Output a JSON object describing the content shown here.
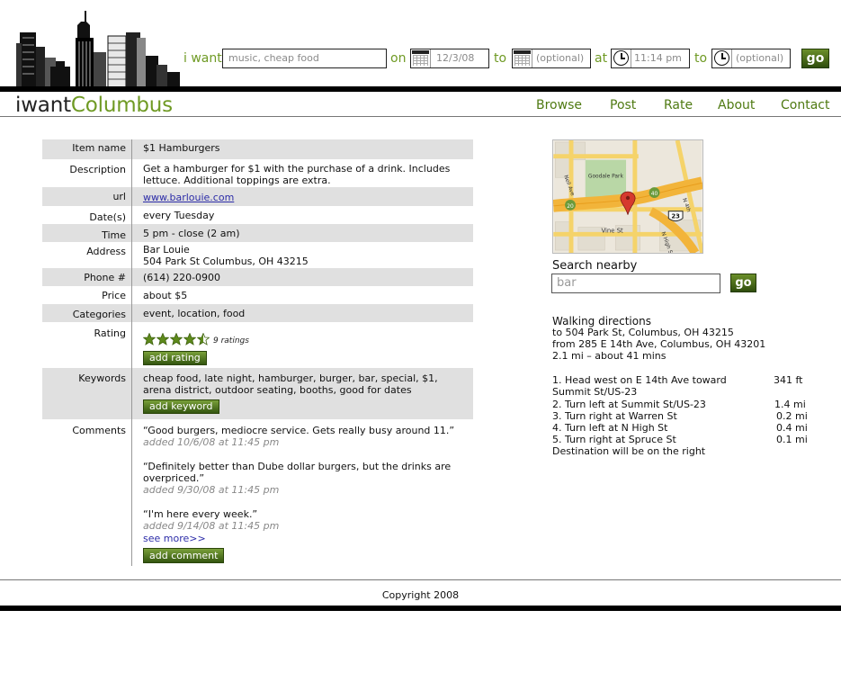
{
  "header": {
    "labels": {
      "want": "i want",
      "on": "on",
      "to1": "to",
      "at": "at",
      "to2": "to"
    },
    "inputs": {
      "want": "music, cheap food",
      "date_from": "12/3/08",
      "date_to": "(optional)",
      "time_from": "11:14 pm",
      "time_to": "(optional)"
    },
    "go_label": "go",
    "logo": {
      "part1": "iwant",
      "part2": "Columbus"
    },
    "nav": [
      "Browse",
      "Post",
      "Rate",
      "About",
      "Contact"
    ]
  },
  "detail": {
    "item_name": {
      "label": "Item name",
      "value": "$1 Hamburgers"
    },
    "description": {
      "label": "Description",
      "value": "Get a hamburger for $1 with the purchase of a drink. Includes lettuce. Additional toppings are extra."
    },
    "url": {
      "label": "url",
      "value": "www.barlouie.com"
    },
    "dates": {
      "label": "Date(s)",
      "value": "every Tuesday"
    },
    "time": {
      "label": "Time",
      "value": "5 pm - close (2 am)"
    },
    "address": {
      "label": "Address",
      "line1": "Bar Louie",
      "line2": "504 Park St Columbus, OH 43215"
    },
    "phone": {
      "label": "Phone #",
      "value": "(614) 220-0900"
    },
    "price": {
      "label": "Price",
      "value": "about $5"
    },
    "categories": {
      "label": "Categories",
      "value": "event, location, food"
    },
    "rating": {
      "label": "Rating",
      "stars": 4.5,
      "count_text": "9 ratings",
      "button": "add rating"
    },
    "keywords": {
      "label": "Keywords",
      "value": "cheap food, late night, hamburger, burger, bar, special, $1, arena district, outdoor seating, booths, good for dates",
      "button": "add keyword"
    },
    "comments": {
      "label": "Comments",
      "items": [
        {
          "text": "“Good burgers, mediocre service. Gets really busy around 11.”",
          "meta": "added 10/6/08 at 11:45 pm"
        },
        {
          "text": "“Definitely better than Dube dollar burgers, but the drinks are overpriced.”",
          "meta": "added 9/30/08 at 11:45 pm"
        },
        {
          "text": "“I'm here every week.”",
          "meta": "added 9/14/08 at 11:45 pm"
        }
      ],
      "see_more": "see more>>",
      "button": "add comment"
    }
  },
  "map": {
    "labels": {
      "park": "Goodale Park",
      "neil": "Neil Ave",
      "vine": "Vine St",
      "high": "N High St",
      "route23": "23",
      "route20": "20",
      "route40": "40",
      "n4th": "N 4th"
    }
  },
  "search": {
    "title": "Search nearby",
    "value": "bar",
    "go_label": "go"
  },
  "directions": {
    "title": "Walking directions",
    "to": "to 504 Park St, Columbus, OH 43215",
    "from": "from 285 E 14th Ave, Columbus, OH 43201",
    "summary": "2.1 mi – about 41 mins",
    "steps": [
      {
        "text": "1. Head west on E 14th Ave toward",
        "text2": "Summit St/US-23",
        "dist": "341 ft"
      },
      {
        "text": "2. Turn left at Summit St/US-23",
        "dist": "1.4 mi"
      },
      {
        "text": "3. Turn right at Warren St",
        "dist": "0.2 mi"
      },
      {
        "text": "4. Turn left at N High St",
        "dist": "0.4 mi"
      },
      {
        "text": "5. Turn right at Spruce St",
        "dist": "0.1 mi"
      }
    ],
    "destination": "Destination will be on the right"
  },
  "footer": {
    "copyright": "Copyright 2008"
  },
  "colors": {
    "accent": "#6f9a24",
    "nav": "#4f7a12",
    "button_top": "#7aa03a",
    "button_bottom": "#34560f",
    "shade": "#e0e0e0",
    "link": "#2c2ca8"
  }
}
